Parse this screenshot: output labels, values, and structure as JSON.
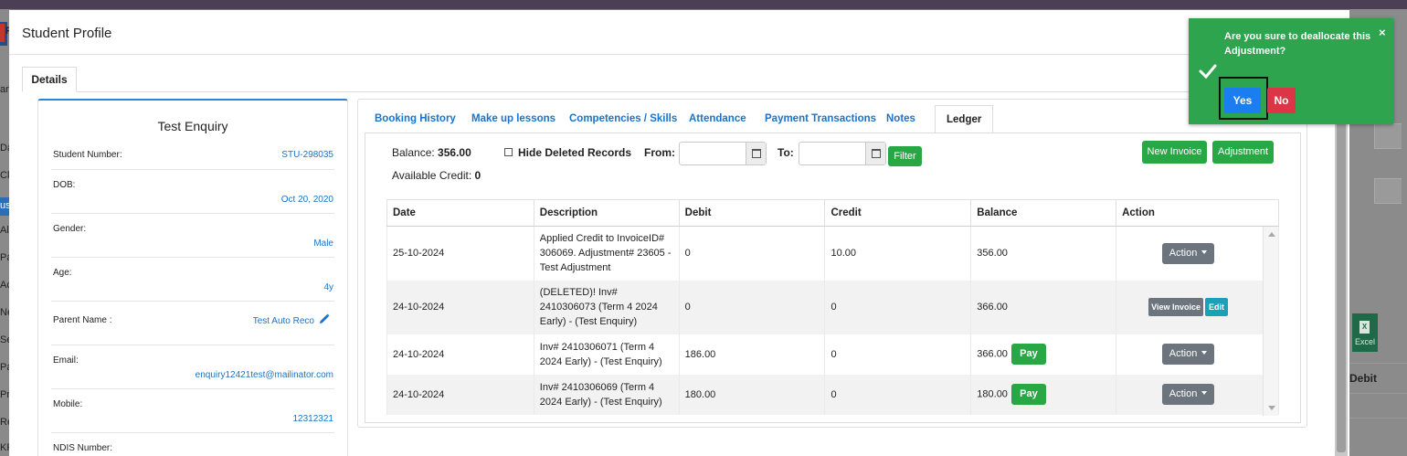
{
  "background": {
    "left_fragments": [
      "F",
      "an",
      "Das",
      "Cla",
      "ust",
      "All",
      "Par",
      "Act",
      "Nev",
      "Set",
      "Pay",
      "Pro",
      "Rep",
      "KPI"
    ],
    "excel_label": "Excel",
    "excel_icon_letter": "X",
    "debit_header": "Debit"
  },
  "modal": {
    "title": "Student Profile",
    "details_tab": "Details"
  },
  "profile": {
    "name": "Test Enquiry",
    "fields": {
      "student_number": {
        "label": "Student Number:",
        "value": "STU-298035"
      },
      "dob": {
        "label": "DOB:",
        "value": "Oct 20, 2020"
      },
      "gender": {
        "label": "Gender:",
        "value": "Male"
      },
      "age": {
        "label": "Age:",
        "value": "4y"
      },
      "parent_name": {
        "label": "Parent Name :",
        "value": "Test Auto Reco"
      },
      "email": {
        "label": "Email:",
        "value": "enquiry12421test@mailinator.com"
      },
      "mobile": {
        "label": "Mobile:",
        "value": "12312321"
      },
      "ndis": {
        "label": "NDIS Number:",
        "value": ""
      }
    }
  },
  "tabs": [
    {
      "label": "Booking History"
    },
    {
      "label": "Make up lessons"
    },
    {
      "label": "Competencies / Skills"
    },
    {
      "label": "Attendance"
    },
    {
      "label": "Payment Transactions"
    },
    {
      "label": "Notes"
    },
    {
      "label": "Ledger"
    }
  ],
  "ledger": {
    "balance_label": "Balance:",
    "balance_value": "356.00",
    "credit_label": "Available Credit:",
    "credit_value": "0",
    "hide_deleted_label": "Hide Deleted Records",
    "hide_deleted_checked": false,
    "from_label": "From:",
    "to_label": "To:",
    "from_value": "",
    "to_value": "",
    "filter_label": "Filter",
    "new_invoice_label": "New Invoice",
    "adjustment_label": "Adjustment",
    "columns": [
      "Date",
      "Description",
      "Debit",
      "Credit",
      "Balance",
      "Action"
    ],
    "rows": [
      {
        "date": "25-10-2024",
        "description": "Applied Credit to InvoiceID# 306069. Adjustment# 23605 - Test Adjustment",
        "debit": "0",
        "credit": "10.00",
        "balance": "356.00",
        "action": "Action"
      },
      {
        "date": "24-10-2024",
        "description": "(DELETED)! Inv# 2410306073 (Term 4 2024 Early) - (Test Enquiry)",
        "debit": "0",
        "credit": "0",
        "balance": "366.00",
        "view_invoice": "View Invoice",
        "edit": "Edit"
      },
      {
        "date": "24-10-2024",
        "description": "Inv# 2410306071 (Term 4 2024 Early) - (Test Enquiry)",
        "debit": "186.00",
        "credit": "0",
        "balance": "366.00",
        "pay": "Pay",
        "action": "Action"
      },
      {
        "date": "24-10-2024",
        "description": "Inv# 2410306069 (Term 4 2024 Early) - (Test Enquiry)",
        "debit": "180.00",
        "credit": "0",
        "balance": "180.00",
        "pay": "Pay",
        "action": "Action"
      }
    ]
  },
  "toast": {
    "message": "Are you sure to deallocate this Adjustment?",
    "close": "×",
    "yes": "Yes",
    "no": "No"
  }
}
